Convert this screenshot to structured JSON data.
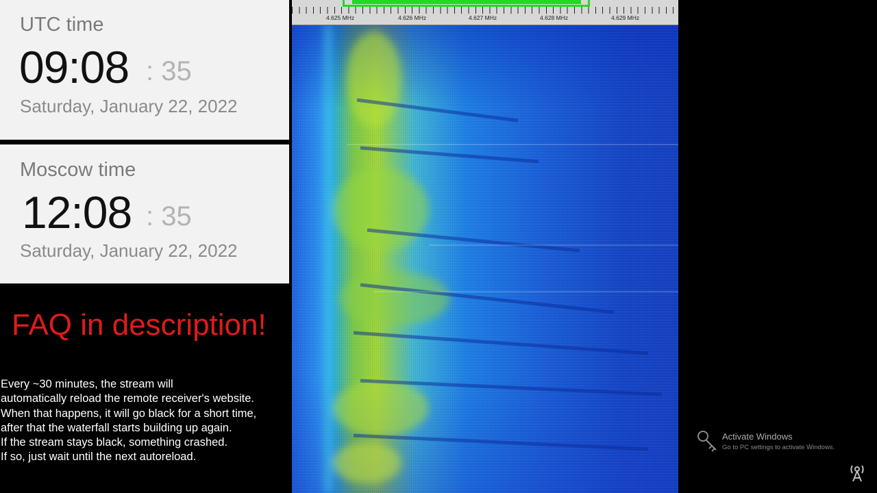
{
  "utc_clock": {
    "label": "UTC time",
    "hours_minutes": "09:08",
    "seconds": ": 35",
    "date": "Saturday, January 22, 2022"
  },
  "moscow_clock": {
    "label": "Moscow time",
    "hours_minutes": "12:08",
    "seconds": ": 35",
    "date": "Saturday, January 22, 2022"
  },
  "faq_banner": "FAQ in description!",
  "info_lines": [
    "Every ~30 minutes, the stream will",
    "automatically reload the remote receiver's website.",
    "When that happens, it will go black for a short time,",
    "after that the waterfall starts building up again.",
    "If the stream stays black, something crashed.",
    "If so, just wait until the next autoreload."
  ],
  "waterfall": {
    "frequency_labels": [
      "4.625 MHz",
      "4.626 MHz",
      "4.627 MHz",
      "4.628 MHz",
      "4.629 MHz"
    ],
    "colors": {
      "passband": "#1fdc22",
      "low": "#1540c2",
      "mid": "#1aa8e8",
      "high": "#a0d63a"
    }
  },
  "windows_watermark": {
    "title": "Activate Windows",
    "subtitle": "Go to PC settings to activate Windows.",
    "icon": "key-icon"
  },
  "overlay_icon": "antenna-icon"
}
